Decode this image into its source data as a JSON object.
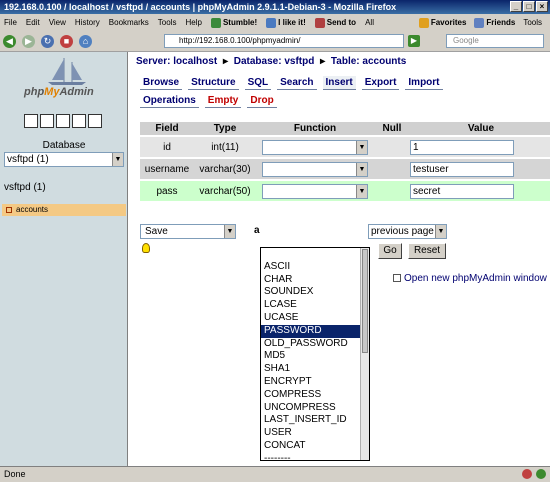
{
  "window": {
    "title": "192.168.0.100 / localhost / vsftpd / accounts | phpMyAdmin 2.9.1.1-Debian-3 - Mozilla Firefox"
  },
  "menu": {
    "items": [
      "File",
      "Edit",
      "View",
      "History",
      "Bookmarks",
      "Tools",
      "Help"
    ],
    "stumble": "Stumble!",
    "like": "I like it!",
    "sendto": "Send to",
    "all": "All",
    "favorites": "Favorites",
    "friends": "Friends",
    "tools": "Tools"
  },
  "nav": {
    "url": "http://192.168.0.100/phpmyadmin/",
    "search_placeholder": "Google"
  },
  "sidebar": {
    "logo_php": "php",
    "logo_my": "My",
    "logo_admin": "Admin",
    "database_label": "Database",
    "database_value": "vsftpd (1)",
    "db_name": "vsftpd (1)",
    "table_item": "accounts"
  },
  "breadcrumb": {
    "server": "Server: localhost",
    "database": "Database: vsftpd",
    "table": "Table: accounts"
  },
  "tabs": {
    "browse": "Browse",
    "structure": "Structure",
    "sql": "SQL",
    "search": "Search",
    "insert": "Insert",
    "export": "Export",
    "import": "Import",
    "operations": "Operations",
    "empty": "Empty",
    "drop": "Drop"
  },
  "grid": {
    "headers": {
      "field": "Field",
      "type": "Type",
      "function": "Function",
      "null": "Null",
      "value": "Value"
    },
    "rows": [
      {
        "field": "id",
        "type": "int(11)",
        "value": "1"
      },
      {
        "field": "username",
        "type": "varchar(30)",
        "value": "testuser"
      },
      {
        "field": "pass",
        "type": "varchar(50)",
        "value": "secret"
      }
    ]
  },
  "actions": {
    "save": "Save",
    "and": "a",
    "after": "previous page",
    "go": "Go",
    "reset": "Reset",
    "new_window": "Open new phpMyAdmin window"
  },
  "dropdown": {
    "options": [
      "",
      "ASCII",
      "CHAR",
      "SOUNDEX",
      "LCASE",
      "UCASE",
      "PASSWORD",
      "OLD_PASSWORD",
      "MD5",
      "SHA1",
      "ENCRYPT",
      "COMPRESS",
      "UNCOMPRESS",
      "LAST_INSERT_ID",
      "USER",
      "CONCAT",
      "--------"
    ],
    "selected": "PASSWORD"
  },
  "status": {
    "text": "Done"
  }
}
